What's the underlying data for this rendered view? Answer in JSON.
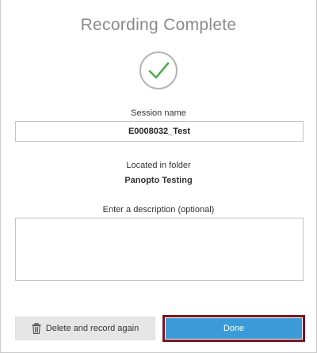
{
  "dialog": {
    "title": "Recording Complete",
    "status_icon": "checkmark-circle-icon"
  },
  "session": {
    "label": "Session name",
    "value": "E0008032_Test"
  },
  "folder": {
    "label": "Located in folder",
    "value": "Panopto Testing"
  },
  "description": {
    "label": "Enter a description (optional)",
    "value": "",
    "placeholder": ""
  },
  "buttons": {
    "delete_label": "Delete and record again",
    "delete_icon": "trash-icon",
    "done_label": "Done"
  },
  "colors": {
    "accent": "#3b9bd8",
    "success": "#4caf50",
    "focus_outline": "#7a1420"
  }
}
